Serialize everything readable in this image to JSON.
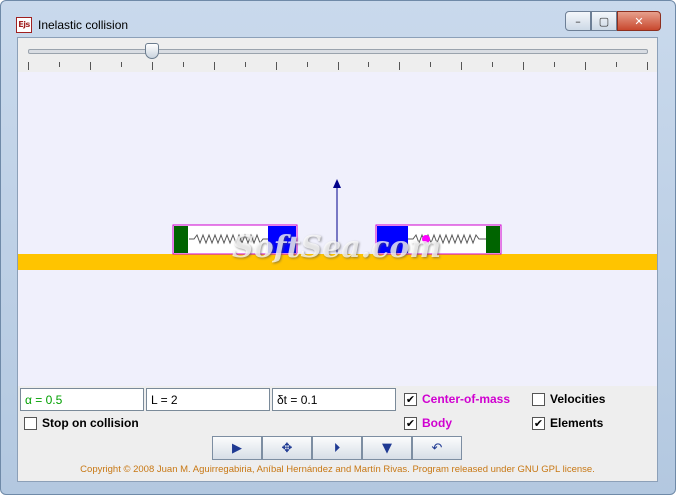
{
  "window": {
    "title": "Inelastic collision",
    "icon_text": "Ejs",
    "controls": {
      "minimize": "–",
      "maximize": "▢",
      "close": "✕"
    }
  },
  "slider": {
    "value_fraction": 0.2,
    "tick_count": 21
  },
  "simulation": {
    "ground_color": "#ffc400",
    "block_fill_color": "#0000ff",
    "end_block_color": "#006400",
    "spring_color": "#555555",
    "center_of_mass_color": "#ff00ff",
    "arrow_color": "#00008b",
    "watermark": "SoftSea.com"
  },
  "params": {
    "alpha_value": "α = 0.5",
    "length_value": "L = 2",
    "dt_value": "δt = 0.1"
  },
  "options": {
    "center_of_mass": {
      "label": "Center-of-mass",
      "checked": true
    },
    "velocities": {
      "label": "Velocities",
      "checked": false
    },
    "body": {
      "label": "Body",
      "checked": true
    },
    "elements": {
      "label": "Elements",
      "checked": true
    },
    "stop_on_collision": {
      "label": "Stop on collision",
      "checked": false
    }
  },
  "buttons": {
    "play": "▶",
    "step_both": "✥",
    "step": "⏵",
    "down": "▼",
    "reset": "↶"
  },
  "footer": "Copyright © 2008 Juan M. Aguirregabiria, Aníbal Hernández and Martín Rivas. Program released under GNU GPL license."
}
